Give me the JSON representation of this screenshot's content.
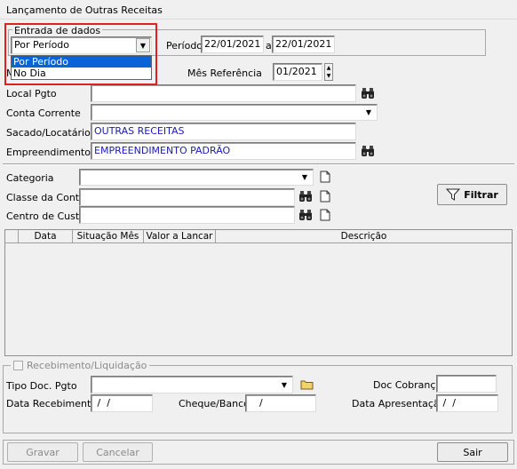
{
  "window": {
    "title": "Lançamento de Outras Receitas"
  },
  "entrada": {
    "group_label": "Entrada de dados",
    "selected": "Por Período",
    "options": [
      "Por Período",
      "No Dia"
    ]
  },
  "periodo": {
    "label": "Período",
    "start": "22/01/2021",
    "sep": "a",
    "end": "22/01/2021"
  },
  "mes_ref": {
    "label": "Mês Referência",
    "value": "01/2021"
  },
  "hidden_label_fragment": "M",
  "local_pgto": {
    "label": "Local Pgto",
    "value": ""
  },
  "conta_corrente": {
    "label": "Conta Corrente",
    "value": ""
  },
  "sacado": {
    "label": "Sacado/Locatário",
    "value": "OUTRAS RECEITAS"
  },
  "empreendimento": {
    "label": "Empreendimento",
    "value": "EMPREENDIMENTO PADRÃO"
  },
  "categoria": {
    "label": "Categoria",
    "value": ""
  },
  "classe": {
    "label": "Classe da Conta",
    "value": ""
  },
  "centro": {
    "label": "Centro de Custo",
    "value": ""
  },
  "filtrar": {
    "label": "Filtrar"
  },
  "grid": {
    "columns": [
      "",
      "Data",
      "Situação Mês",
      "Valor a Lancar",
      "Descrição"
    ]
  },
  "recebimento": {
    "group_label": "Recebimento/Liquidação",
    "tipo_doc_label": "Tipo Doc. Pgto",
    "tipo_doc_value": "",
    "doc_cobranca_label": "Doc Cobrança",
    "doc_cobranca_value": "",
    "data_receb_label": "Data Recebimento",
    "data_receb_value": " /  /",
    "cheque_label": "Cheque/Banco",
    "cheque_value": "/",
    "data_apres_label": "Data Apresentação",
    "data_apres_value": " /  /"
  },
  "buttons": {
    "gravar": "Gravar",
    "cancelar": "Cancelar",
    "sair": "Sair"
  },
  "icons": {
    "combo": "dropdown-arrow-icon",
    "search": "binoculars-icon",
    "new": "new-document-icon",
    "folder": "folder-icon",
    "filter": "funnel-icon"
  }
}
